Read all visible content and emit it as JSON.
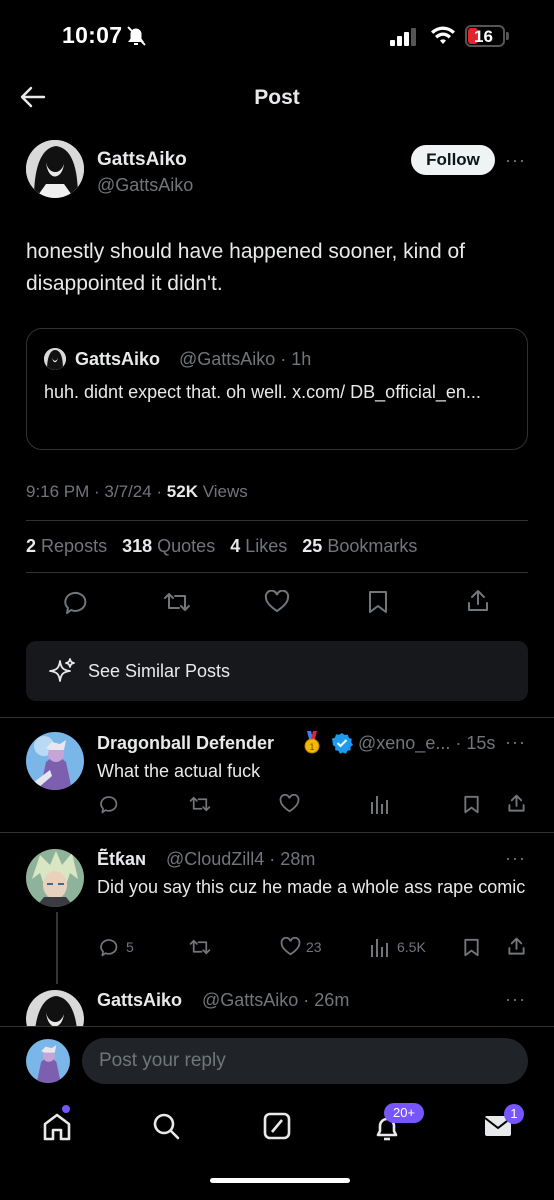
{
  "status_bar": {
    "time": "10:07",
    "battery": "16"
  },
  "header": {
    "title": "Post"
  },
  "post": {
    "author_name": "GattsAiko",
    "author_handle": "@GattsAiko",
    "follow_label": "Follow",
    "more": "···",
    "text": "honestly should have happened sooner, kind of disappointed it didn't.",
    "quote": {
      "name": "GattsAiko",
      "handle_time": "@GattsAiko · 1h",
      "text": "huh. didnt expect that. oh well. x.com/ DB_official_en..."
    },
    "timestamp": "9:16 PM · 3/7/24 · ",
    "views_count": "52K",
    "views_label": " Views",
    "stats": {
      "reposts_count": "2",
      "reposts_label": "Reposts",
      "quotes_count": "318",
      "quotes_label": "Quotes",
      "likes_count": "4",
      "likes_label": "Likes",
      "bookmarks_count": "25",
      "bookmarks_label": "Bookmarks"
    },
    "see_similar": "See Similar Posts"
  },
  "replies": [
    {
      "name": "Dragonball Defender",
      "handle_time": "@xeno_e... · 15s",
      "text": "What the actual fuck",
      "comments": "",
      "reposts": "",
      "likes": "",
      "views": ""
    },
    {
      "name": "Ẽ̈tƙaɴ",
      "handle_time": "@CloudZill4 · 28m",
      "text": "Did you say this cuz he made a whole ass rape comic",
      "comments": "5",
      "likes": "23",
      "views": "6.5K"
    },
    {
      "name": "GattsAiko",
      "handle_time": "@GattsAiko · 26m",
      "text": ""
    }
  ],
  "reply_box": {
    "placeholder": "Post your reply"
  },
  "tabbar": {
    "notifications_badge": "20+",
    "messages_badge": "1"
  },
  "colors": {
    "background": "#000000",
    "accent_blue": "#1d9bf0",
    "badge_purple": "#7856ff",
    "muted": "#71767b"
  }
}
